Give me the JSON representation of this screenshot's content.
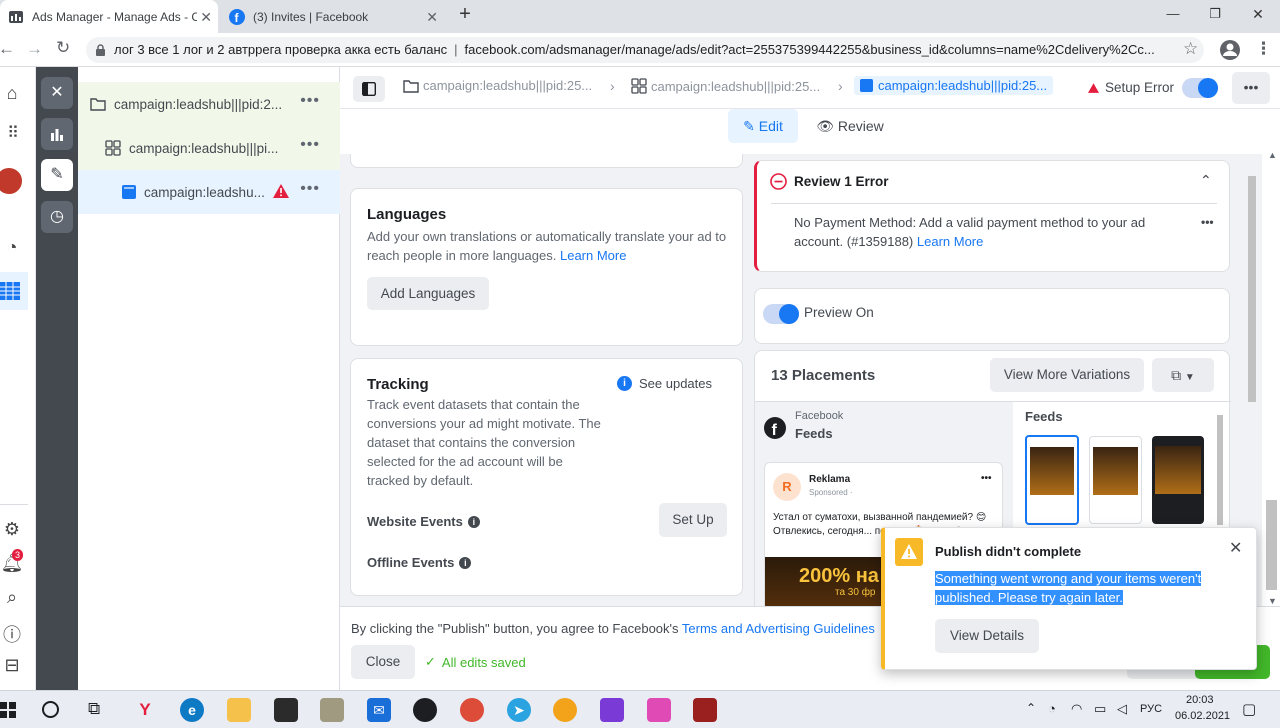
{
  "browser": {
    "tabs": [
      {
        "title": "Ads Manager - Manage Ads - Ca"
      },
      {
        "title": "(3) Invites | Facebook"
      }
    ],
    "new_tab": "+",
    "window_controls": {
      "minimize": "—",
      "maximize": "❐",
      "close": "✕"
    },
    "address": {
      "page_title": "лог 3 все 1 лог и 2 автррега проверка акка есть баланс",
      "url": "facebook.com/adsmanager/manage/ads/edit?act=255375399442255&business_id&columns=name%2Cdelivery%2Cc..."
    }
  },
  "tree": {
    "items": [
      {
        "label": "campaign:leadshub|||pid:2..."
      },
      {
        "label": "campaign:leadshub|||pi..."
      },
      {
        "label": "campaign:leadshu..."
      }
    ],
    "more": "•••"
  },
  "rail": {
    "badge": "3"
  },
  "breadcrumbs": [
    {
      "label": "campaign:leadshub|||pid:25..."
    },
    {
      "label": "campaign:leadshub|||pid:25..."
    },
    {
      "label": "campaign:leadshub|||pid:25..."
    }
  ],
  "setup_status": {
    "label": "Setup Error"
  },
  "more_button": "•••",
  "modes": {
    "edit": "Edit",
    "review": "Review"
  },
  "languages": {
    "title": "Languages",
    "desc": "Add your own translations or automatically translate your ad to reach people in more languages.",
    "link": "Learn More",
    "button": "Add Languages"
  },
  "tracking": {
    "title": "Tracking",
    "see_updates": "See updates",
    "desc": "Track event datasets that contain the conversions your ad might motivate. The dataset that contains the conversion selected for the ad account will be tracked by default.",
    "website_events": "Website Events",
    "setup_button": "Set Up",
    "offline_events": "Offline Events"
  },
  "review_error": {
    "title": "Review 1 Error",
    "message": "No Payment Method: Add a valid payment method to your ad account. (#1359188)",
    "link": "Learn More"
  },
  "preview": {
    "label": "Preview On"
  },
  "placements": {
    "title": "13 Placements",
    "view_more": "View More Variations",
    "platform": "Facebook",
    "placement": "Feeds",
    "feeds_label": "Feeds",
    "post": {
      "page": "Reklama",
      "sponsored": "Sponsored ·",
      "text": "Устал от суматохи, вызванной пандемией? 😊 Отвлекись, сегодня... повезет 🎰 Лови безде...",
      "image_text": "200% на",
      "image_sub": "та 30 фр"
    }
  },
  "footer": {
    "legal_prefix": "By clicking the \"Publish\" button, you agree to Facebook's",
    "legal_link": "Terms and Advertising Guidelines",
    "close": "Close",
    "saved": "All edits saved"
  },
  "toast": {
    "title": "Publish didn't complete",
    "message": "Something went wrong and your items weren't published. Please try again later.",
    "button": "View Details",
    "close": "✕"
  },
  "taskbar": {
    "time": "20:03",
    "date": "06.02.2021",
    "lang": "РУС"
  },
  "colors": {
    "accent": "#1877f2",
    "error": "#e41e3f",
    "warning": "#f7b928",
    "success": "#42b72a"
  }
}
